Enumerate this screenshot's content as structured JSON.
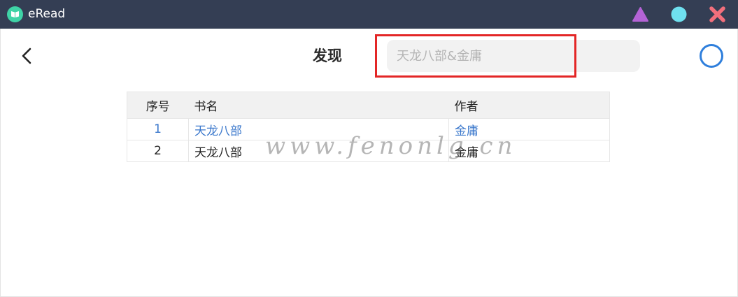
{
  "window": {
    "title": "eRead",
    "accent": "#343e54",
    "controls": [
      {
        "name": "minimize",
        "icon": "triangle-icon",
        "color": "#b463d6"
      },
      {
        "name": "maximize",
        "icon": "circle-icon",
        "color": "#6fe0ef"
      },
      {
        "name": "close",
        "icon": "x-icon",
        "color": "#f26f7c"
      }
    ]
  },
  "header": {
    "title": "发现",
    "search": {
      "value": "",
      "placeholder": "天龙八部&金庸"
    },
    "highlight_color": "#e32626",
    "action_icon": "circle-outline-icon",
    "action_color": "#2f7fdc"
  },
  "table": {
    "columns": [
      "序号",
      "书名",
      "作者"
    ],
    "rows": [
      {
        "index": "1",
        "title": "天龙八部",
        "author": "金庸",
        "selected": true
      },
      {
        "index": "2",
        "title": "天龙八部",
        "author": "金庸",
        "selected": false
      }
    ],
    "selected_color": "#3b78cc"
  },
  "watermark": "www.fenonlg.cn"
}
